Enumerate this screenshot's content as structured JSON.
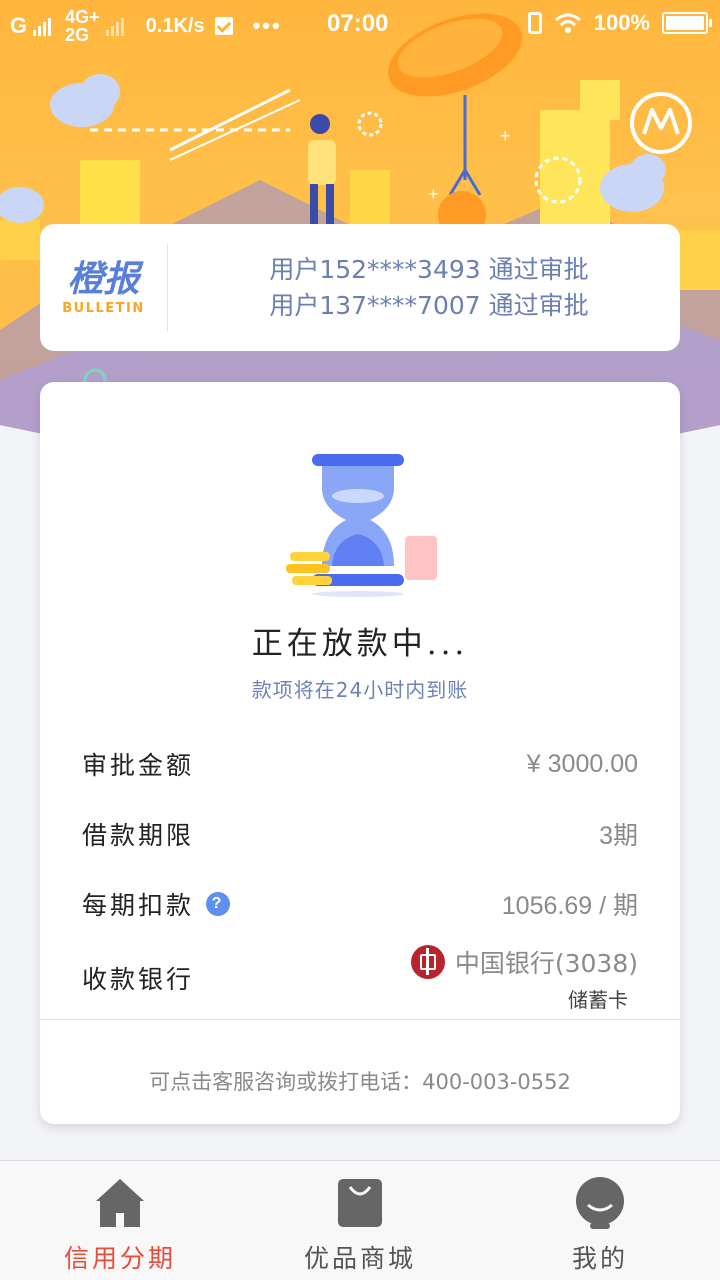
{
  "status_bar": {
    "carrier": "G",
    "network_top": "4G+",
    "network_bottom": "2G",
    "speed": "0.1K/s",
    "dots": "•••",
    "time": "07:00",
    "battery": "100%"
  },
  "bulletin": {
    "brand_cn": "橙报",
    "brand_en": "BULLETIN",
    "items": [
      "用户152****3493 通过审批",
      "用户137****7007 通过审批"
    ]
  },
  "loan": {
    "status_title": "正在放款中...",
    "status_subtitle": "款项将在24小时内到账",
    "rows": [
      {
        "label": "审批金额",
        "value": "¥ 3000.00"
      },
      {
        "label": "借款期限",
        "value": "3期"
      },
      {
        "label": "每期扣款",
        "value": "1056.69 / 期"
      },
      {
        "label": "收款银行",
        "value": "中国银行(3038)"
      }
    ],
    "help_glyph": "?",
    "card_type": "储蓄卡",
    "hotline": "可点击客服咨询或拨打电话：400-003-0552"
  },
  "nav": {
    "items": [
      {
        "label": "信用分期",
        "icon": "home-icon",
        "active": true
      },
      {
        "label": "优品商城",
        "icon": "shopping-bag-icon",
        "active": false
      },
      {
        "label": "我的",
        "icon": "profile-icon",
        "active": false
      }
    ]
  },
  "colors": {
    "hero": "#ffb23a",
    "accent_blue": "#5f8ff0",
    "active_nav": "#e84c3d",
    "bulletin_text": "#6b7fb0"
  }
}
